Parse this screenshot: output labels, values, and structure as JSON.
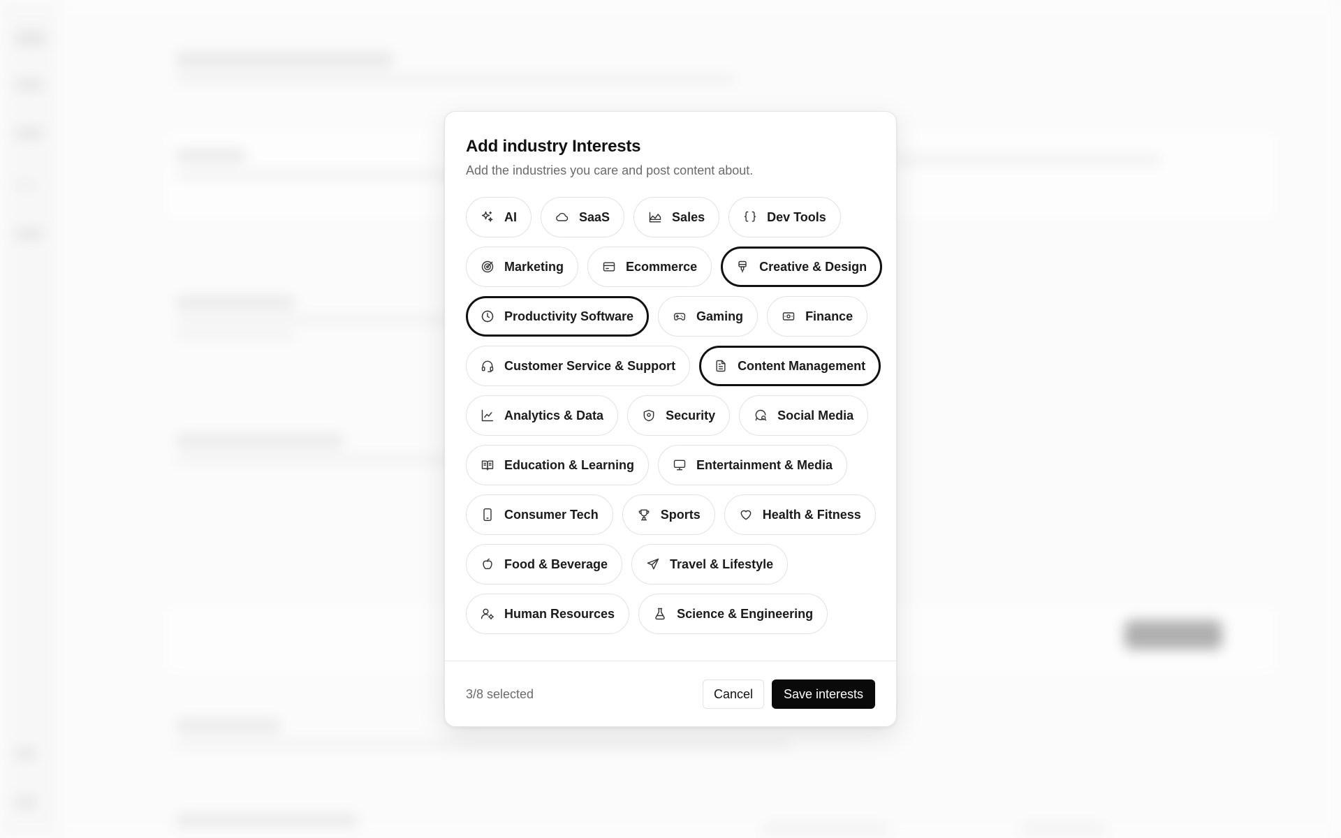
{
  "modal": {
    "title": "Add industry Interests",
    "subtitle": "Add the industries you care and post content about.",
    "chip_rows": [
      [
        {
          "label": "AI",
          "icon": "sparkles-icon",
          "selected": false
        },
        {
          "label": "SaaS",
          "icon": "cloud-icon",
          "selected": false
        },
        {
          "label": "Sales",
          "icon": "chart-area-icon",
          "selected": false
        },
        {
          "label": "Dev Tools",
          "icon": "braces-icon",
          "selected": false
        }
      ],
      [
        {
          "label": "Marketing",
          "icon": "target-icon",
          "selected": false
        },
        {
          "label": "Ecommerce",
          "icon": "credit-card-icon",
          "selected": false
        },
        {
          "label": "Creative & Design",
          "icon": "paintbrush-icon",
          "selected": true
        }
      ],
      [
        {
          "label": "Productivity Software",
          "icon": "clock-icon",
          "selected": true
        },
        {
          "label": "Gaming",
          "icon": "gamepad-icon",
          "selected": false
        },
        {
          "label": "Finance",
          "icon": "banknote-icon",
          "selected": false
        }
      ],
      [
        {
          "label": "Customer Service & Support",
          "icon": "headphones-icon",
          "selected": false
        },
        {
          "label": "Content Management",
          "icon": "file-text-icon",
          "selected": true
        }
      ],
      [
        {
          "label": "Analytics & Data",
          "icon": "line-chart-icon",
          "selected": false
        },
        {
          "label": "Security",
          "icon": "shield-icon",
          "selected": false
        },
        {
          "label": "Social Media",
          "icon": "message-search-icon",
          "selected": false
        }
      ],
      [
        {
          "label": "Education & Learning",
          "icon": "book-open-icon",
          "selected": false
        },
        {
          "label": "Entertainment & Media",
          "icon": "monitor-icon",
          "selected": false
        }
      ],
      [
        {
          "label": "Consumer Tech",
          "icon": "smartphone-icon",
          "selected": false
        },
        {
          "label": "Sports",
          "icon": "trophy-icon",
          "selected": false
        },
        {
          "label": "Health & Fitness",
          "icon": "heart-icon",
          "selected": false
        }
      ],
      [
        {
          "label": "Food & Beverage",
          "icon": "apple-icon",
          "selected": false
        },
        {
          "label": "Travel & Lifestyle",
          "icon": "send-icon",
          "selected": false
        }
      ],
      [
        {
          "label": "Human Resources",
          "icon": "users-cog-icon",
          "selected": false
        },
        {
          "label": "Science & Engineering",
          "icon": "flask-icon",
          "selected": false
        }
      ]
    ],
    "footer": {
      "selected_count": "3/8 selected",
      "cancel_label": "Cancel",
      "save_label": "Save interests"
    }
  }
}
